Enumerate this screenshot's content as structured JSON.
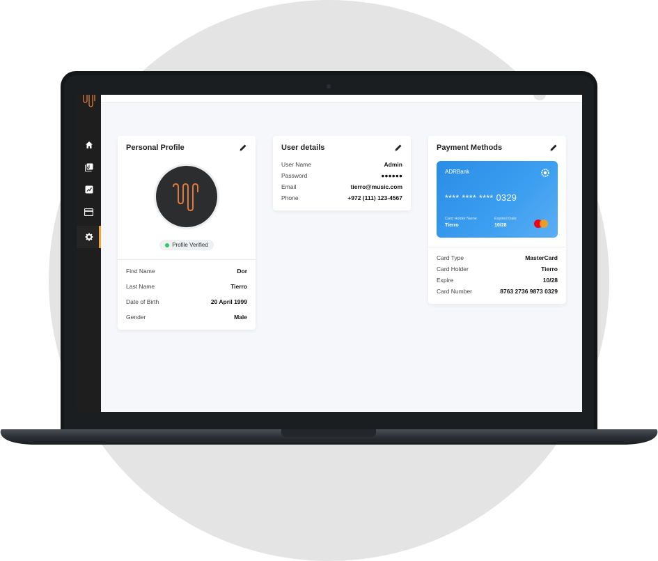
{
  "colors": {
    "accent": "#f0a23b",
    "sidebar_bg": "#1e1e1e",
    "card_gradient_start": "#2a8de6",
    "verified_dot": "#34c759"
  },
  "sidebar": {
    "items": [
      {
        "icon": "home-icon",
        "active": false
      },
      {
        "icon": "music-library-icon",
        "active": false
      },
      {
        "icon": "playlist-icon",
        "active": false
      },
      {
        "icon": "credit-card-icon",
        "active": false
      },
      {
        "icon": "gear-icon",
        "active": true
      }
    ]
  },
  "profile": {
    "title": "Personal Profile",
    "badge": "Profile Verified",
    "fields": [
      {
        "label": "First Name",
        "value": "Dor"
      },
      {
        "label": "Last Name",
        "value": "Tierro"
      },
      {
        "label": "Date of Birth",
        "value": "20 April 1999"
      },
      {
        "label": "Gender",
        "value": "Male"
      }
    ]
  },
  "user_details": {
    "title": "User details",
    "fields": [
      {
        "label": "User Name",
        "value": "Admin"
      },
      {
        "label": "Password",
        "value": "●●●●●●"
      },
      {
        "label": "Email",
        "value": "tierro@music.com"
      },
      {
        "label": "Phone",
        "value": "+972 (111) 123-4567"
      }
    ]
  },
  "payment": {
    "title": "Payment Methods",
    "card": {
      "bank": "ADRBank",
      "masked": "**** **** ****",
      "last4": "0329",
      "holder_label": "Card Holder Name",
      "holder": "Tierro",
      "expiry_label": "Expired Date",
      "expiry": "10/28"
    },
    "fields": [
      {
        "label": "Card Type",
        "value": "MasterCard"
      },
      {
        "label": "Card Holder",
        "value": "Tierro"
      },
      {
        "label": "Expire",
        "value": "10/28"
      },
      {
        "label": "Card Number",
        "value": "8763 2736 9873 0329"
      }
    ]
  }
}
